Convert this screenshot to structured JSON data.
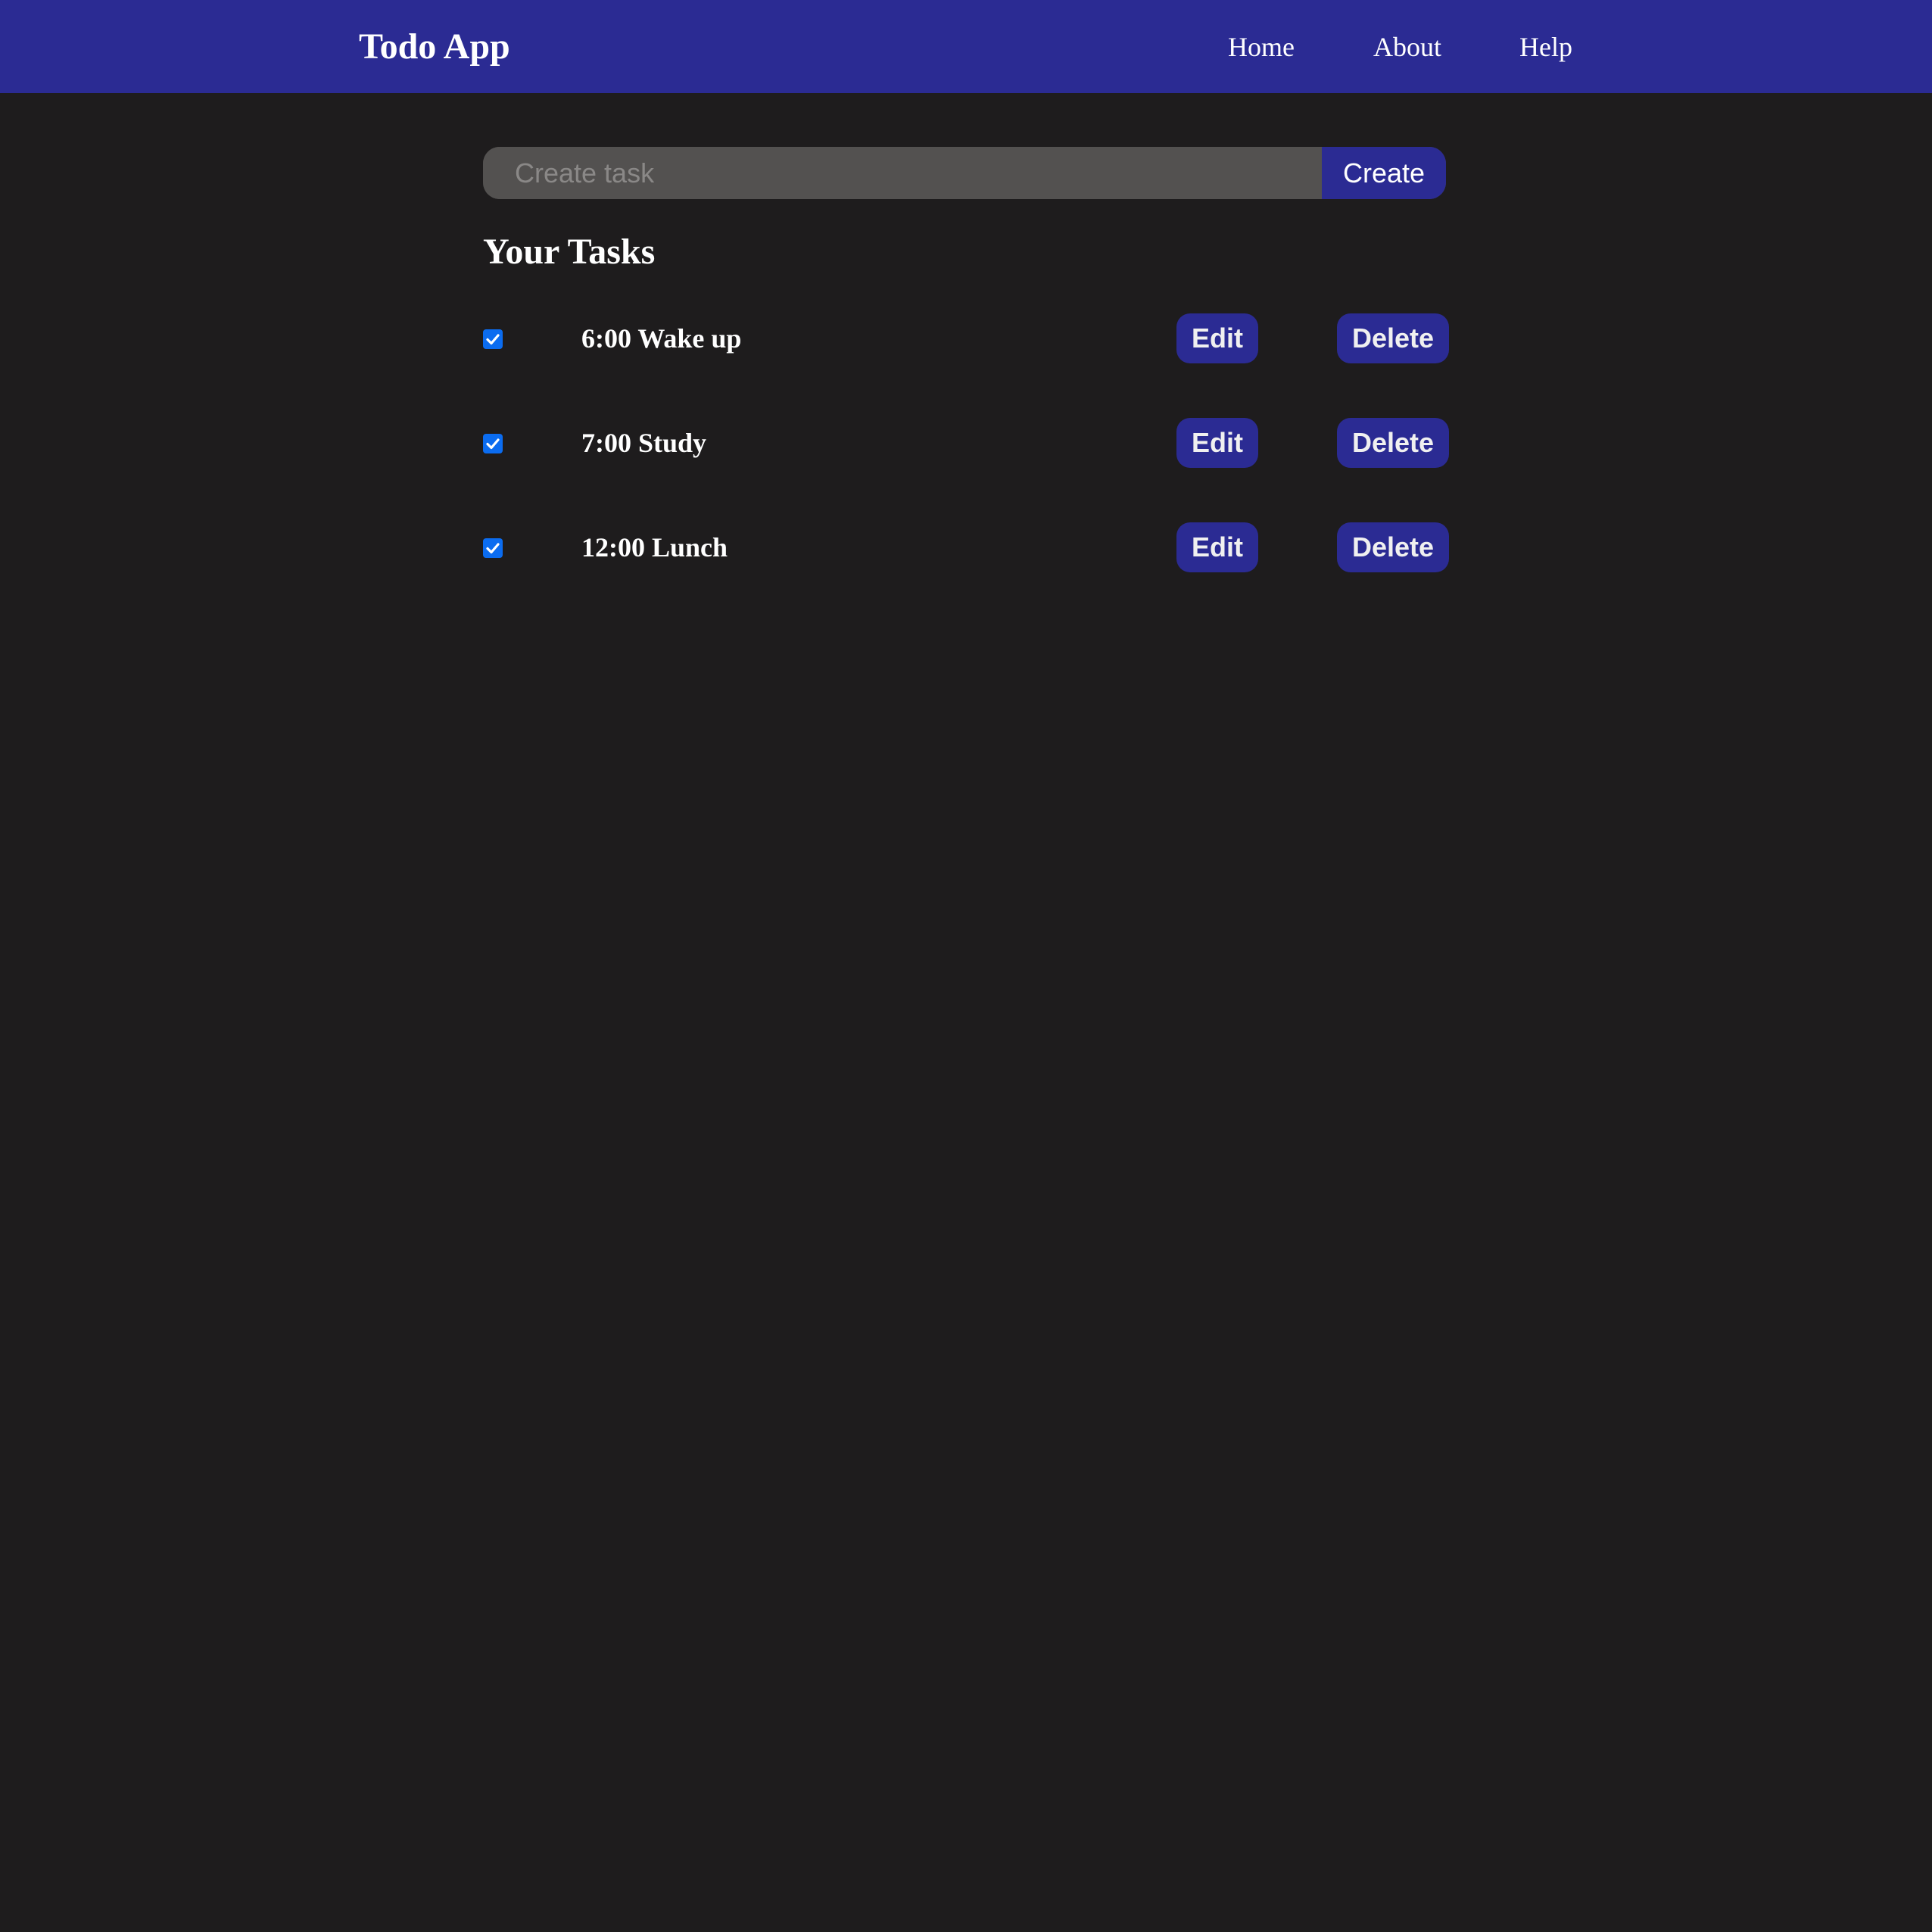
{
  "header": {
    "brand": "Todo App",
    "nav": [
      "Home",
      "About",
      "Help"
    ]
  },
  "create": {
    "placeholder": "Create task",
    "button_label": "Create"
  },
  "tasks_section": {
    "title": "Your Tasks"
  },
  "tasks": [
    {
      "label": "6:00 Wake up",
      "checked": true,
      "edit_label": "Edit",
      "delete_label": "Delete"
    },
    {
      "label": "7:00 Study",
      "checked": true,
      "edit_label": "Edit",
      "delete_label": "Delete"
    },
    {
      "label": "12:00 Lunch",
      "checked": true,
      "edit_label": "Edit",
      "delete_label": "Delete"
    }
  ],
  "colors": {
    "background": "#1e1c1d",
    "accent": "#2b2b93",
    "input_bg": "#535150",
    "checkbox": "#0b6cf0"
  }
}
